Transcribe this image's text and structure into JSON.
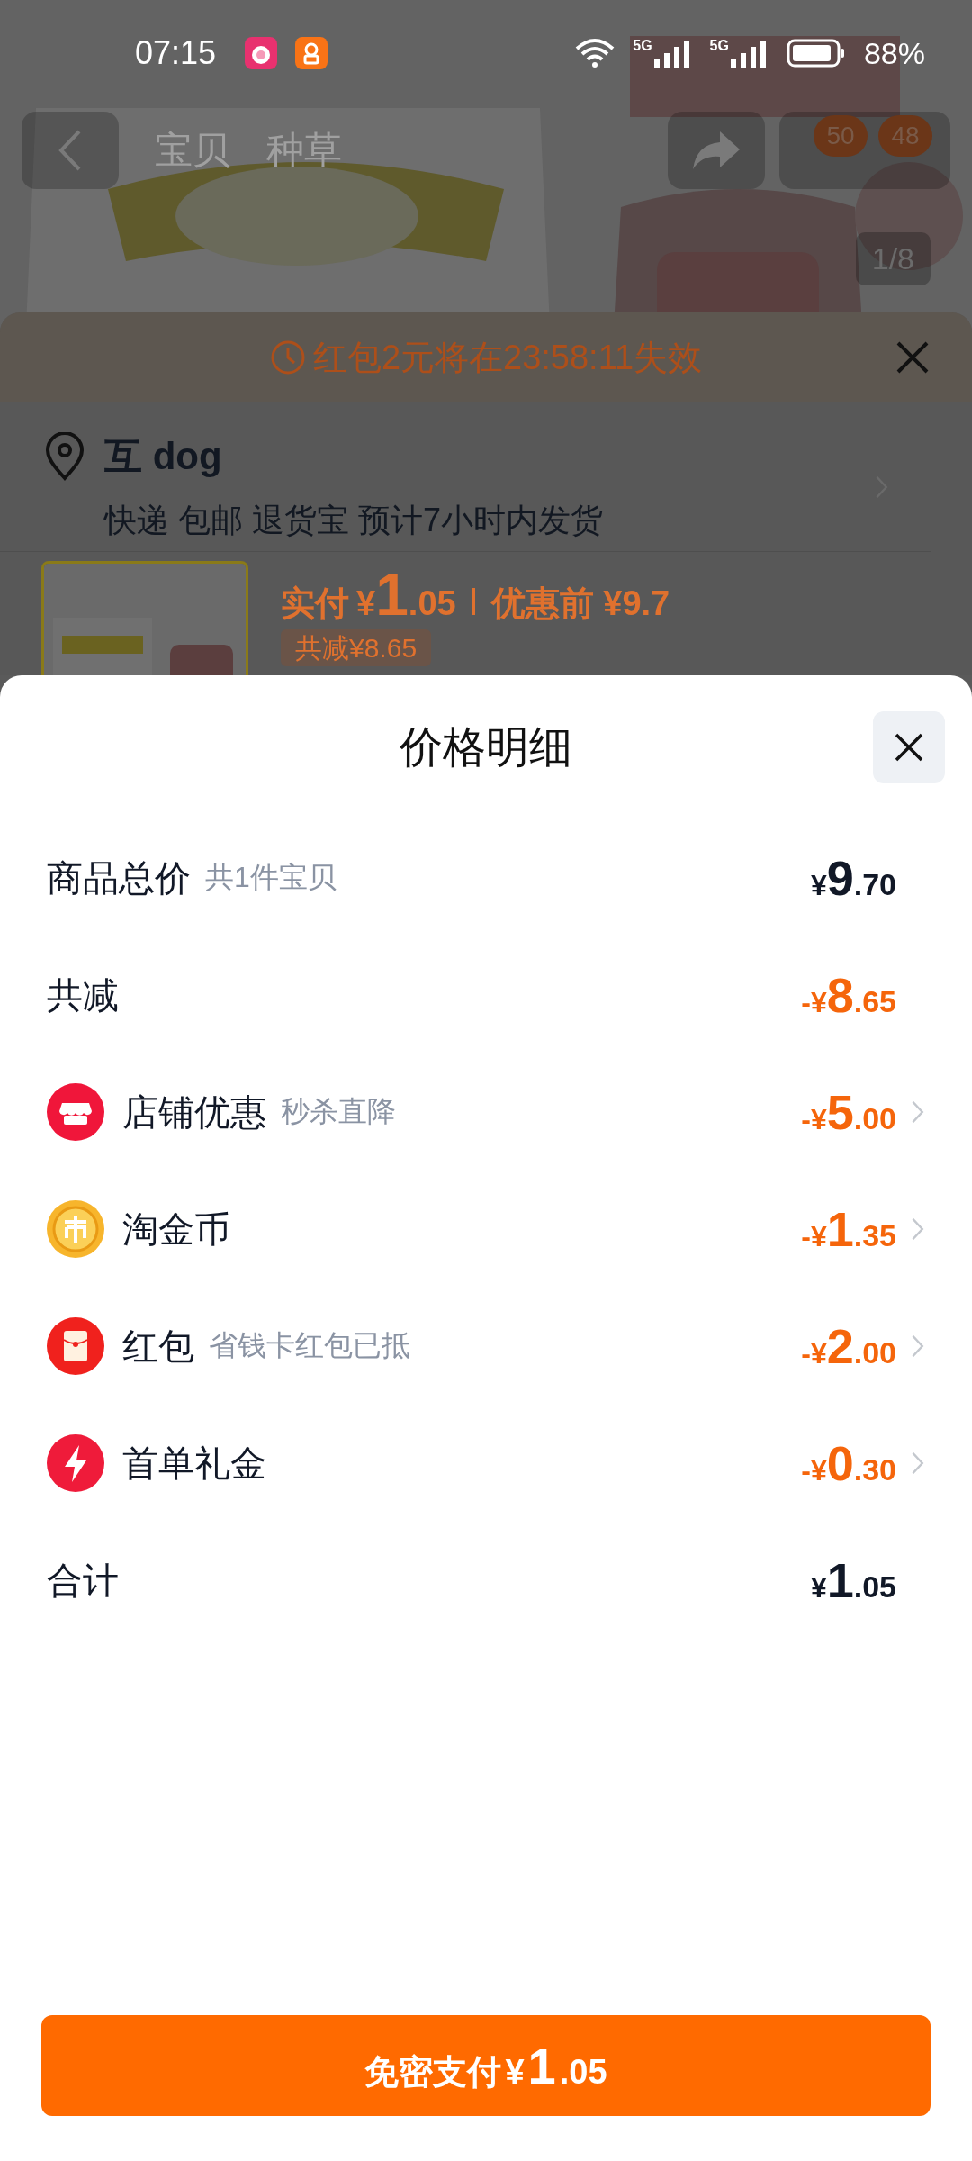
{
  "status_bar": {
    "time": "07:15",
    "network_1": "5G",
    "network_2": "5G",
    "battery": "88%"
  },
  "nav": {
    "tabs": [
      "宝贝",
      "种草"
    ],
    "badges": [
      "50",
      "48"
    ],
    "image_counter": "1/8"
  },
  "order_sheet": {
    "countdown": "红包2元将在23:58:11失效",
    "address": {
      "name": "互 dog",
      "details": "快递 包邮 退货宝 预计7小时内发货"
    },
    "product": {
      "paid_label": "实付",
      "paid_currency": "¥",
      "paid_integer": "1",
      "paid_fraction": ".05",
      "before_label": "优惠前 ¥9.7",
      "discount_tag": "共减¥8.65"
    }
  },
  "price_detail": {
    "title": "价格明细",
    "rows": [
      {
        "kind": "plain",
        "label": "商品总价",
        "note": "共1件宝贝",
        "chevron": false,
        "amount": {
          "prefix": "¥",
          "integer": "9",
          "fraction": ".70"
        }
      },
      {
        "kind": "reduction",
        "label": "共减",
        "chevron": false,
        "amount": {
          "prefix": "-¥",
          "integer": "8",
          "fraction": ".65"
        }
      },
      {
        "kind": "store",
        "label": "店铺优惠",
        "note": "秒杀直降",
        "chevron": true,
        "amount": {
          "prefix": "-¥",
          "integer": "5",
          "fraction": ".00"
        }
      },
      {
        "kind": "coin",
        "label": "淘金币",
        "chevron": true,
        "amount": {
          "prefix": "-¥",
          "integer": "1",
          "fraction": ".35"
        }
      },
      {
        "kind": "packet",
        "label": "红包",
        "note": "省钱卡红包已抵",
        "chevron": true,
        "amount": {
          "prefix": "-¥",
          "integer": "2",
          "fraction": ".00"
        }
      },
      {
        "kind": "bolt",
        "label": "首单礼金",
        "chevron": true,
        "amount": {
          "prefix": "-¥",
          "integer": "0",
          "fraction": ".30"
        }
      },
      {
        "kind": "plain",
        "label": "合计",
        "chevron": false,
        "amount": {
          "prefix": "¥",
          "integer": "1",
          "fraction": ".05"
        }
      }
    ],
    "pay_button": {
      "label": "免密支付",
      "prefix": "¥",
      "integer": "1",
      "fraction": ".05"
    }
  }
}
